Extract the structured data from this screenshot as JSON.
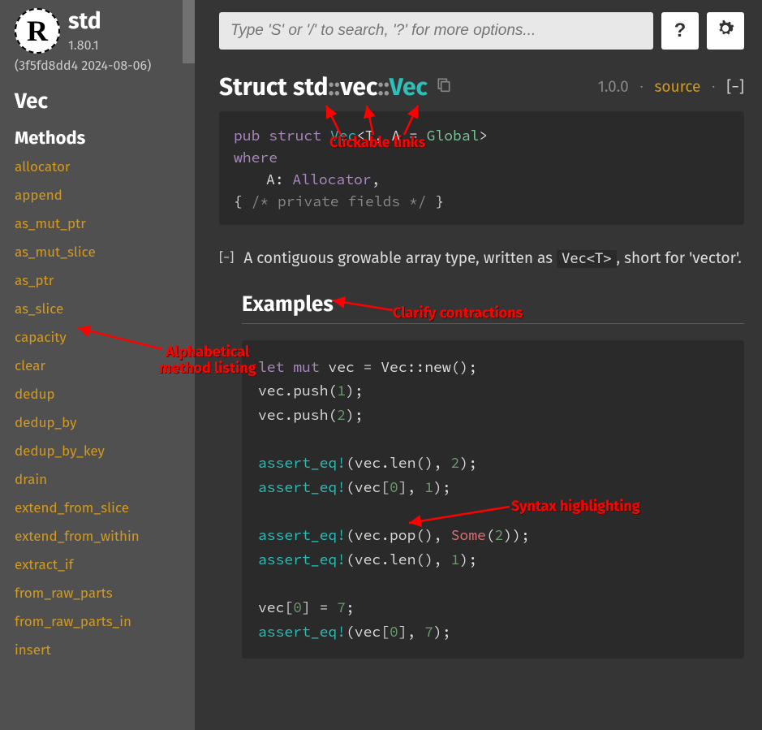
{
  "sidebar": {
    "crate": "std",
    "version": "1.80.1",
    "build": "(3f5fd8dd4 2024-08-06)",
    "type_name": "Vec",
    "methods_label": "Methods",
    "methods": [
      "allocator",
      "append",
      "as_mut_ptr",
      "as_mut_slice",
      "as_ptr",
      "as_slice",
      "capacity",
      "clear",
      "dedup",
      "dedup_by",
      "dedup_by_key",
      "drain",
      "extend_from_slice",
      "extend_from_within",
      "extract_if",
      "from_raw_parts",
      "from_raw_parts_in",
      "insert"
    ]
  },
  "search": {
    "placeholder": "Type 'S' or '/' to search, '?' for more options..."
  },
  "help_label": "?",
  "title": {
    "kind": "Struct",
    "path1": "std",
    "path2": "vec",
    "name": "Vec"
  },
  "meta": {
    "since": "1.0.0",
    "source": "source",
    "collapse": "[−]"
  },
  "signature": {
    "line1_pub": "pub",
    "line1_struct": "struct",
    "line1_name": "Vec",
    "line1_generics_open": "<T, A = ",
    "line1_global": "Global",
    "line1_generics_close": ">",
    "line2_where": "where",
    "line3_a": "A",
    "line3_colon": ": ",
    "line3_trait": "Allocator",
    "line3_comma": ",",
    "line4_open": "{ ",
    "line4_comment": "/* private fields */",
    "line4_close": " }"
  },
  "description": {
    "pre": "A contiguous growable array type, written as ",
    "code": "Vec<T>",
    "mid": ", short for ",
    "quote": "'vector'."
  },
  "collapse_inline": "[−]",
  "examples_heading": "Examples",
  "example": {
    "l1": {
      "let": "let",
      "mut": "mut",
      "vec": " vec = Vec::new();"
    },
    "l2": {
      "pre": "vec.push(",
      "n": "1",
      "post": ");"
    },
    "l3": {
      "pre": "vec.push(",
      "n": "2",
      "post": ");"
    },
    "l5": {
      "mac": "assert_eq!",
      "pre": "(vec.len(), ",
      "n": "2",
      "post": ");"
    },
    "l6": {
      "mac": "assert_eq!",
      "pre": "(vec[",
      "i": "0",
      "mid": "], ",
      "n": "1",
      "post": ");"
    },
    "l8": {
      "mac": "assert_eq!",
      "pre": "(vec.pop(), ",
      "some": "Some",
      "open": "(",
      "n": "2",
      "close": "));"
    },
    "l9": {
      "mac": "assert_eq!",
      "pre": "(vec.len(), ",
      "n": "1",
      "post": ");"
    },
    "l11": {
      "pre": "vec[",
      "i": "0",
      "mid": "] = ",
      "n": "7",
      "post": ";"
    },
    "l12": {
      "mac": "assert_eq!",
      "pre": "(vec[",
      "i": "0",
      "mid": "], ",
      "n": "7",
      "post": ");"
    }
  },
  "annotations": {
    "clickable": "Clickable links",
    "alpha": "Alphabetical method listing",
    "clarify": "Clarify contractions",
    "syntax": "Syntax highlighting"
  }
}
